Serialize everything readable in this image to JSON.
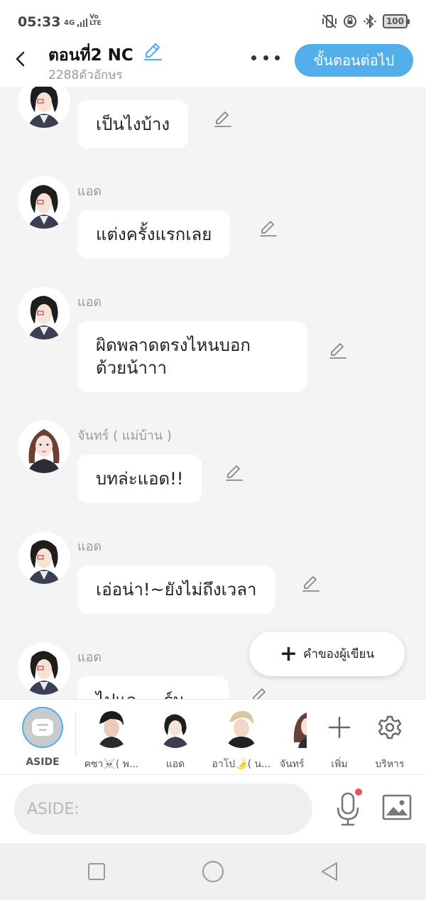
{
  "status_bar": {
    "time": "05:33",
    "network": "4G",
    "volte": "Vo LTE",
    "battery": "100"
  },
  "header": {
    "title": "ตอนที่2 NC",
    "subtitle": "2288ตัวอักษร",
    "next_button": "ขั้นตอนต่อไป"
  },
  "messages": [
    {
      "sender": "",
      "text": "เป็นไงบ้าง",
      "avatar": "ad"
    },
    {
      "sender": "แอด",
      "text": "แต่งครั้งแรกเลย",
      "avatar": "ad"
    },
    {
      "sender": "แอด",
      "text": "ผิดพลาดตรงไหนบอก\nด้วยน้าาา",
      "avatar": "ad"
    },
    {
      "sender": "จันทร์ ( แม่บ้าน )",
      "text": "บทล่ะแอด!!",
      "avatar": "jan"
    },
    {
      "sender": "แอด",
      "text": "เอ่อน่า!~ยังไม่ถึงเวลา",
      "avatar": "ad"
    },
    {
      "sender": "แอด",
      "text": "ไปแล ... ร์ม",
      "avatar": "ad"
    }
  ],
  "author_note_button": "คำของผู้เขียน",
  "characters": [
    {
      "name": "ASIDE"
    },
    {
      "name": "คซา☠️( พ..."
    },
    {
      "name": "แอด"
    },
    {
      "name": "อาโป🌛( น..."
    },
    {
      "name": "จันทร์"
    }
  ],
  "tools": {
    "add_label": "เพิ่ม",
    "manage_label": "บริหาร"
  },
  "input": {
    "placeholder": "ASIDE:"
  },
  "colors": {
    "accent": "#54aeea",
    "aside_label": "#3b8fd8",
    "background": "#f4f4f5",
    "mic_dot": "#f04e5e"
  }
}
